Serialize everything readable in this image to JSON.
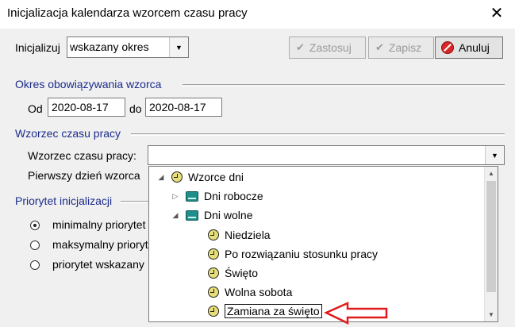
{
  "window": {
    "title": "Inicjalizacja kalendarza wzorcem czasu pracy",
    "close_symbol": "✕"
  },
  "toolbar": {
    "init_label": "Inicjalizuj",
    "init_value": "wskazany okres",
    "apply_label": "Zastosuj",
    "save_label": "Zapisz",
    "cancel_label": "Anuluj"
  },
  "period": {
    "section_title": "Okres obowiązywania wzorca",
    "from_label": "Od",
    "from_value": "2020-08-17",
    "to_label": "do",
    "to_value": "2020-08-17"
  },
  "pattern": {
    "section_title": "Wzorzec czasu pracy",
    "pattern_label": "Wzorzec czasu pracy:",
    "pattern_value": "",
    "first_day_label": "Pierwszy dzień wzorca"
  },
  "priority": {
    "section_title": "Priorytet inicjalizacji",
    "options": [
      "minimalny priorytet",
      "maksymalny priorytet",
      "priorytet wskazany"
    ],
    "selected_index": 0
  },
  "tree": {
    "items": [
      {
        "label": "Wzorce dni",
        "icon": "clock-icon",
        "expander": "expanded"
      },
      {
        "label": "Dni robocze",
        "icon": "book-icon",
        "expander": "collapsed"
      },
      {
        "label": "Dni wolne",
        "icon": "book-icon",
        "expander": "expanded"
      },
      {
        "label": "Niedziela",
        "icon": "clock-icon"
      },
      {
        "label": "Po rozwiązaniu stosunku pracy",
        "icon": "clock-icon"
      },
      {
        "label": "Święto",
        "icon": "clock-icon"
      },
      {
        "label": "Wolna sobota",
        "icon": "clock-icon"
      },
      {
        "label": "Zamiana za święto",
        "icon": "clock-icon",
        "selected": true
      }
    ]
  },
  "colors": {
    "section_title": "#1b2b8a",
    "annotation_arrow": "#e01b1b",
    "clock_fill": "#e6df77",
    "book_fill": "#1e8f8a"
  }
}
